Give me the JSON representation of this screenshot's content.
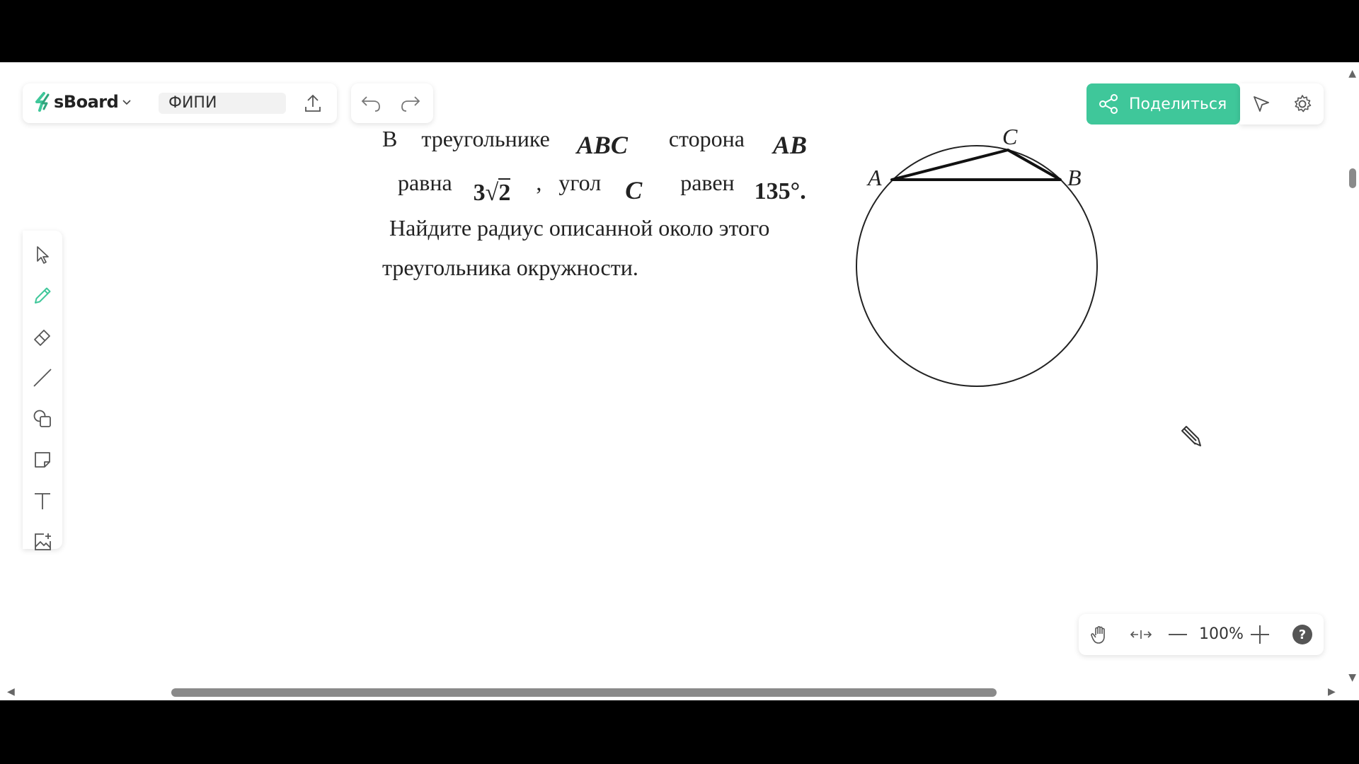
{
  "app": {
    "name": "sBoard",
    "board_name": "ФИПИ",
    "brand_color": "#3fc79a"
  },
  "header": {
    "share_label": "Поделиться"
  },
  "tools": [
    "select",
    "pen",
    "eraser",
    "line",
    "shapes",
    "sticky-note",
    "text",
    "image"
  ],
  "problem": {
    "w_v": "В",
    "w_tri": "треугольнике",
    "abc": "ABC",
    "w_side": "сторона",
    "ab": "AB",
    "w_equal": "равна",
    "coef": "3",
    "rad": "2",
    "comma": ",",
    "w_angle": "угол",
    "c": "C",
    "w_is": "равен",
    "deg": "135°.",
    "line3": "Найдите радиус описанной около этого",
    "line4": "треугольника окружности."
  },
  "figure": {
    "label_a": "A",
    "label_b": "B",
    "label_c": "C"
  },
  "zoom": {
    "value": "100%"
  }
}
